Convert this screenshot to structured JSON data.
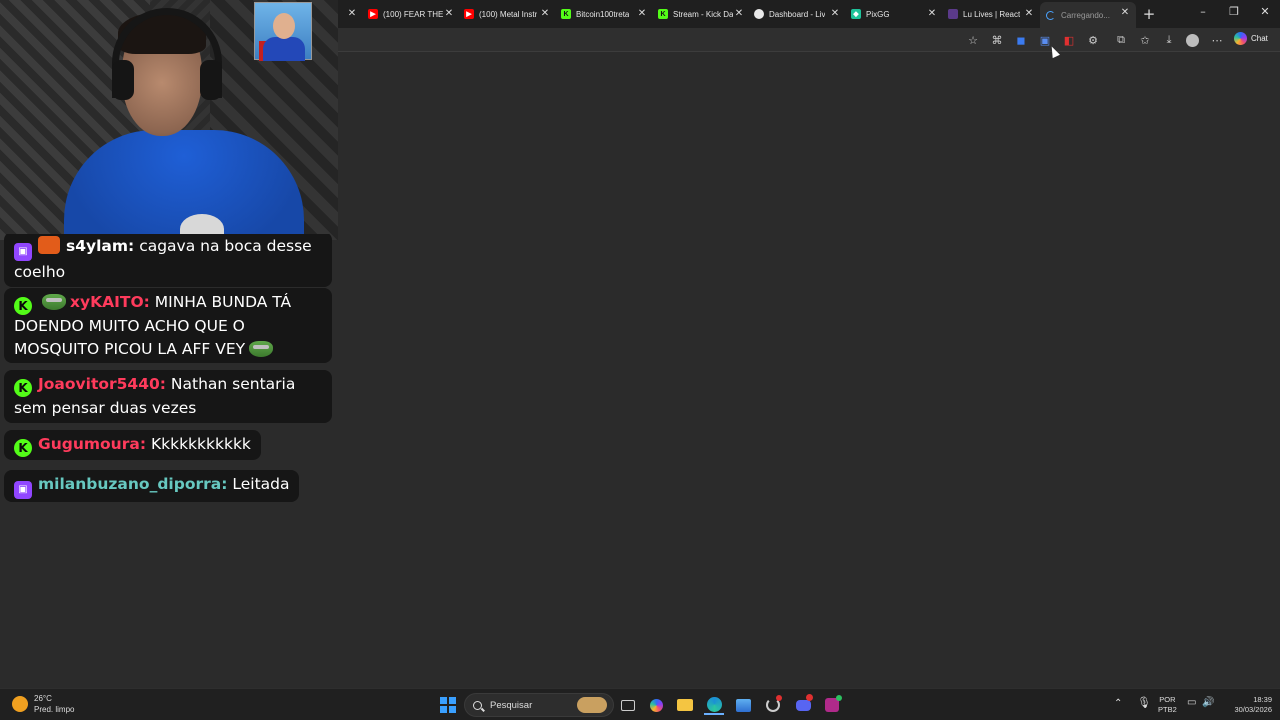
{
  "browser": {
    "tabs": [
      {
        "title": "",
        "icon": "close"
      },
      {
        "title": "(100) FEAR THE",
        "icon": "youtube-icon"
      },
      {
        "title": "(100) Metal Instr",
        "icon": "youtube-icon"
      },
      {
        "title": "Bitcoin100treta",
        "icon": "kick-icon"
      },
      {
        "title": "Stream - Kick Da",
        "icon": "kick-icon"
      },
      {
        "title": "Dashboard - Liv",
        "icon": "globe-icon"
      },
      {
        "title": "PixGG",
        "icon": "pixgg-icon"
      },
      {
        "title": "Lu Lives | React",
        "icon": "site-icon"
      },
      {
        "title": "Carregando...",
        "icon": "loading-icon",
        "active": true
      }
    ],
    "chat_button_label": "Chat"
  },
  "chat": {
    "messages": [
      {
        "platform": "twitch",
        "user": "s4ylam:",
        "text": "cagava na boca desse coelho"
      },
      {
        "platform": "kick",
        "user": "xyKAITO:",
        "text": "MINHA BUNDA TÁ DOENDO MUITO ACHO QUE O MOSQUITO PICOU LA AFF VEY"
      },
      {
        "platform": "kick",
        "user": "Joaovitor5440:",
        "text": "Nathan sentaria sem pensar duas vezes"
      },
      {
        "platform": "kick",
        "user": "Gugumoura:",
        "text": "Kkkkkkkkkkk"
      },
      {
        "platform": "twitch",
        "user": "milanbuzano_diporra:",
        "text": "Leitada"
      }
    ]
  },
  "taskbar": {
    "weather_temp": "26°C",
    "weather_desc": "Pred. limpo",
    "search_placeholder": "Pesquisar",
    "lang_line1": "POR",
    "lang_line2": "PTB2",
    "time": "18:39",
    "date": "30/03/2026"
  },
  "colors": {
    "kick": "#53fc18",
    "twitch": "#9146ff",
    "username_red": "#ff3b5c",
    "username_teal": "#67c8c0"
  }
}
